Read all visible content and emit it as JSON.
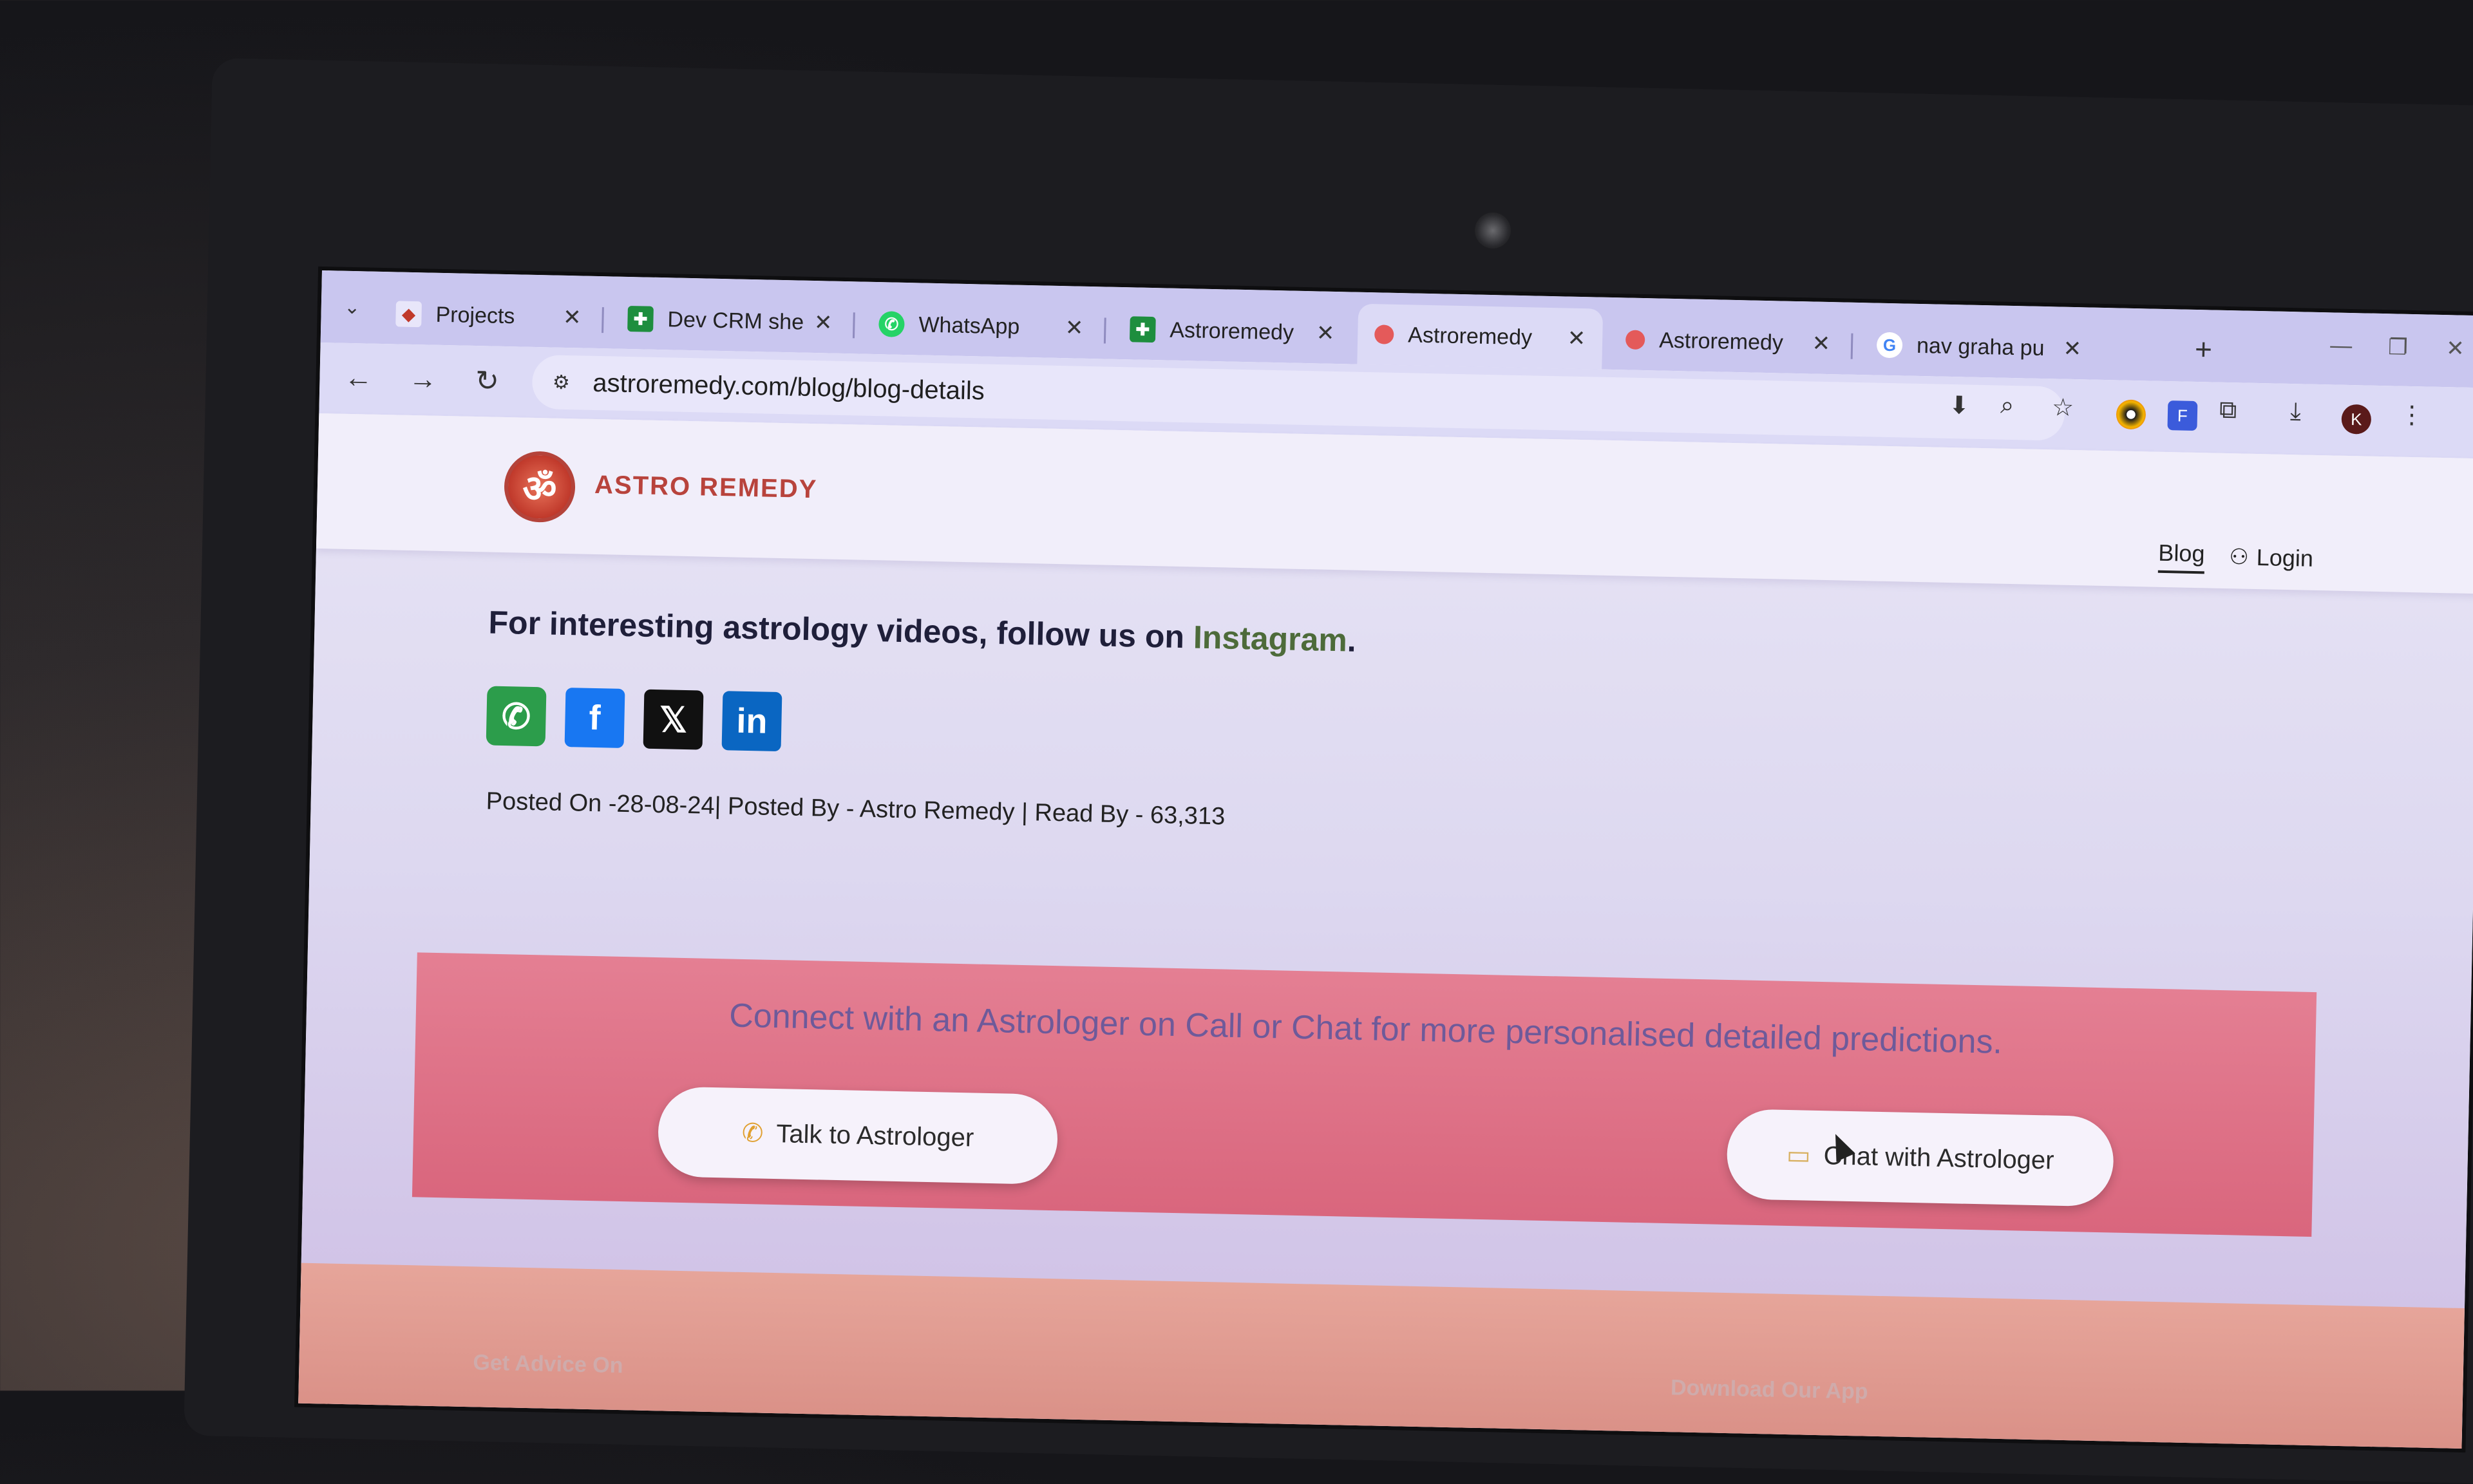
{
  "browser": {
    "tabs": [
      {
        "title": "Projects",
        "favicon": "projects-icon",
        "active": false
      },
      {
        "title": "Dev CRM she",
        "favicon": "sheets-icon",
        "active": false
      },
      {
        "title": "WhatsApp",
        "favicon": "whatsapp-icon",
        "active": false
      },
      {
        "title": "Astroremedy",
        "favicon": "sheets-icon",
        "active": false
      },
      {
        "title": "Astroremedy",
        "favicon": "astroremedy-icon",
        "active": true
      },
      {
        "title": "Astroremedy",
        "favicon": "astroremedy-icon",
        "active": false
      },
      {
        "title": "nav graha pu",
        "favicon": "google-icon",
        "active": false
      }
    ],
    "close_glyph": "✕",
    "new_tab_glyph": "+",
    "url": "astroremedy.com/blog/blog-details",
    "profile_initial": "K"
  },
  "site": {
    "logo_text": "ASTRO REMEDY",
    "logo_symbol": "ॐ",
    "nav": {
      "blog": "Blog",
      "login": "Login"
    }
  },
  "article": {
    "follow_prefix": "For interesting astrology videos, follow us on ",
    "follow_link": "Instagram",
    "follow_suffix": ".",
    "share": [
      "whatsapp-icon",
      "facebook-icon",
      "x-icon",
      "linkedin-icon"
    ],
    "meta": "Posted On -28-08-24| Posted By - Astro Remedy | Read By - 63,313"
  },
  "cta": {
    "text": "Connect with an Astrologer on Call or Chat for more personalised detailed predictions.",
    "talk_label": "Talk to Astrologer",
    "chat_label": "Chat with Astrologer"
  },
  "footer": {
    "left_heading": "Get Advice On",
    "right_heading": "Download Our App"
  },
  "colors": {
    "tab_bar": "#c9c6ef",
    "cta_background": "#e47f93",
    "brand_red": "#c0392b",
    "instagram_link": "#4d6b3a"
  }
}
